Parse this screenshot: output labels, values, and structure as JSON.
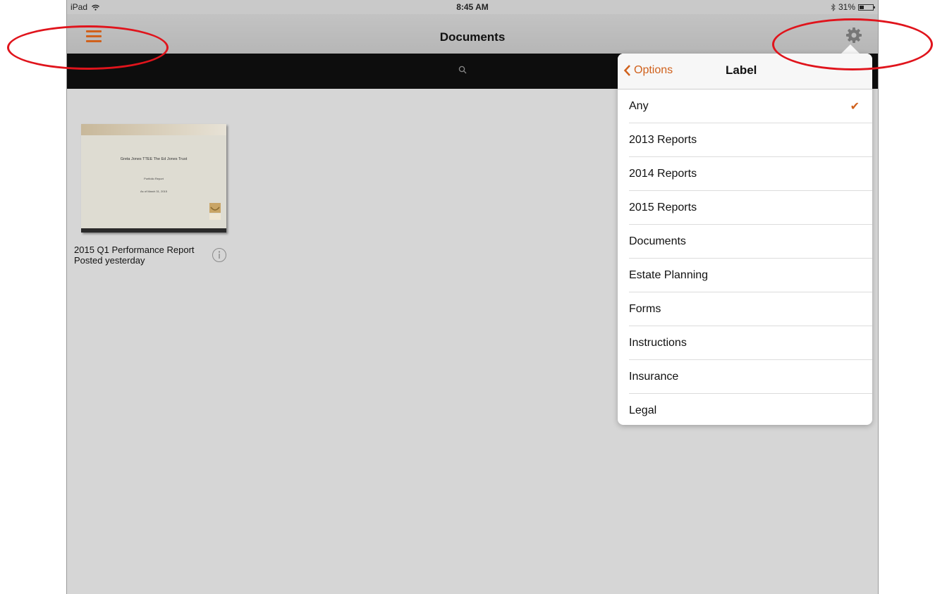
{
  "status_bar": {
    "device": "iPad",
    "time": "8:45 AM",
    "battery": "31%"
  },
  "nav": {
    "title": "Documents"
  },
  "document": {
    "thumb_title": "Greta Jones TTEE The Ed Jones Trust",
    "thumb_subtitle": "Portfolio Report",
    "thumb_date": "As of March 31, 2015",
    "name": "2015 Q1 Performance Report",
    "posted": "Posted yesterday"
  },
  "popover": {
    "back_label": "Options",
    "title": "Label",
    "items": [
      {
        "label": "Any",
        "selected": true
      },
      {
        "label": "2013 Reports",
        "selected": false
      },
      {
        "label": "2014 Reports",
        "selected": false
      },
      {
        "label": "2015 Reports",
        "selected": false
      },
      {
        "label": "Documents",
        "selected": false
      },
      {
        "label": "Estate Planning",
        "selected": false
      },
      {
        "label": "Forms",
        "selected": false
      },
      {
        "label": "Instructions",
        "selected": false
      },
      {
        "label": "Insurance",
        "selected": false
      },
      {
        "label": "Legal",
        "selected": false
      }
    ]
  },
  "colors": {
    "accent": "#d0611c",
    "annotation": "#e0141c"
  },
  "icons": [
    "wifi-icon",
    "bluetooth-icon",
    "battery-icon",
    "hamburger-menu-icon",
    "gear-icon",
    "search-icon",
    "info-icon",
    "chevron-left-icon",
    "checkmark-icon"
  ]
}
